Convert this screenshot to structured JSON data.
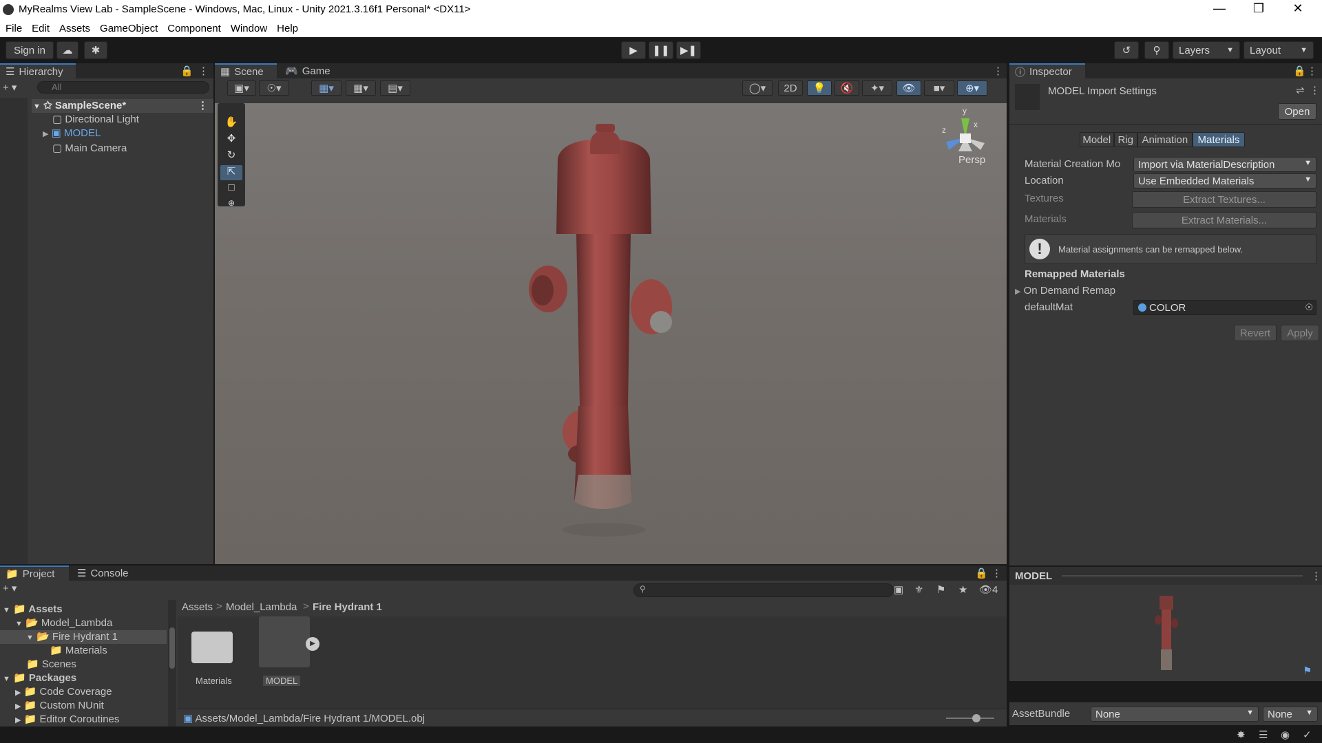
{
  "window": {
    "title": "MyRealms View Lab - SampleScene - Windows, Mac, Linux - Unity 2021.3.16f1 Personal* <DX11>"
  },
  "menu": [
    "File",
    "Edit",
    "Assets",
    "GameObject",
    "Component",
    "Window",
    "Help"
  ],
  "toolbar": {
    "sign_in": "Sign in",
    "layers": "Layers",
    "layout": "Layout"
  },
  "hierarchy": {
    "tab": "Hierarchy",
    "search_placeholder": "All",
    "scene": "SampleScene*",
    "items": [
      "Directional Light",
      "MODEL",
      "Main Camera"
    ]
  },
  "scene_view": {
    "tabs": [
      "Scene",
      "Game"
    ],
    "mode_2d": "2D",
    "persp": "Persp",
    "axes": {
      "y": "y",
      "x": "x",
      "z": "z"
    }
  },
  "inspector": {
    "tab": "Inspector",
    "title": "MODEL Import Settings",
    "open": "Open",
    "subtabs": [
      "Model",
      "Rig",
      "Animation",
      "Materials"
    ],
    "material_creation_label": "Material Creation Mo",
    "material_creation_value": "Import via MaterialDescription",
    "location_label": "Location",
    "location_value": "Use Embedded Materials",
    "textures_label": "Textures",
    "extract_textures": "Extract Textures...",
    "materials_label": "Materials",
    "extract_materials": "Extract Materials...",
    "info": "Material assignments can be remapped below.",
    "remapped_header": "Remapped Materials",
    "on_demand": "On Demand Remap",
    "default_mat_label": "defaultMat",
    "default_mat_value": "COLOR",
    "revert": "Revert",
    "apply": "Apply",
    "preview_title": "MODEL",
    "assetbundle_label": "AssetBundle",
    "assetbundle_value": "None",
    "assetbundle_variant": "None"
  },
  "project": {
    "tabs": [
      "Project",
      "Console"
    ],
    "hidden_count": "4",
    "tree": [
      {
        "label": "Assets",
        "bold": true
      },
      {
        "label": "Model_Lambda"
      },
      {
        "label": "Fire Hydrant 1"
      },
      {
        "label": "Materials"
      },
      {
        "label": "Scenes"
      },
      {
        "label": "Packages",
        "bold": true
      },
      {
        "label": "Code Coverage"
      },
      {
        "label": "Custom NUnit"
      },
      {
        "label": "Editor Coroutines"
      }
    ],
    "breadcrumb": [
      "Assets",
      "Model_Lambda",
      "Fire Hydrant 1"
    ],
    "assets": [
      "Materials",
      "MODEL"
    ],
    "path": "Assets/Model_Lambda/Fire Hydrant 1/MODEL.obj"
  },
  "colors": {
    "accent": "#3a79bb",
    "selected": "#2c5d87",
    "hydrant": "#a04c48"
  }
}
